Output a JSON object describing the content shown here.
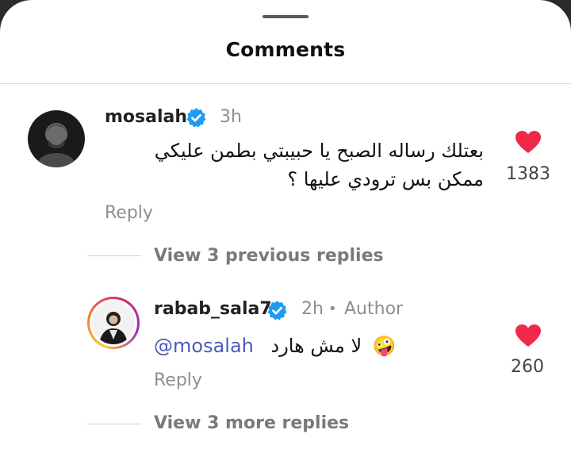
{
  "sheet": {
    "title": "Comments"
  },
  "comments": [
    {
      "username": "mosalah",
      "time": "3h",
      "text_line1": "بعتلك رساله الصبح يا حبيبتي بطمن عليكي",
      "text_line2": "ممكن بس ترودي عليها ؟",
      "reply_label": "Reply",
      "likes": "1383",
      "view_replies": "View 3 previous replies"
    },
    {
      "username": "rabab_sala7",
      "time": "2h",
      "separator": "•",
      "author_badge": "Author",
      "mention": "@mosalah",
      "text": "لا مش هارد",
      "emoji": "🤪",
      "reply_label": "Reply",
      "likes": "260",
      "view_replies": "View 3 more replies"
    }
  ],
  "colors": {
    "heart": "#f02849",
    "verified": "#1d9bf0",
    "mention": "#4a5bb8",
    "muted": "#8e8e8e"
  }
}
